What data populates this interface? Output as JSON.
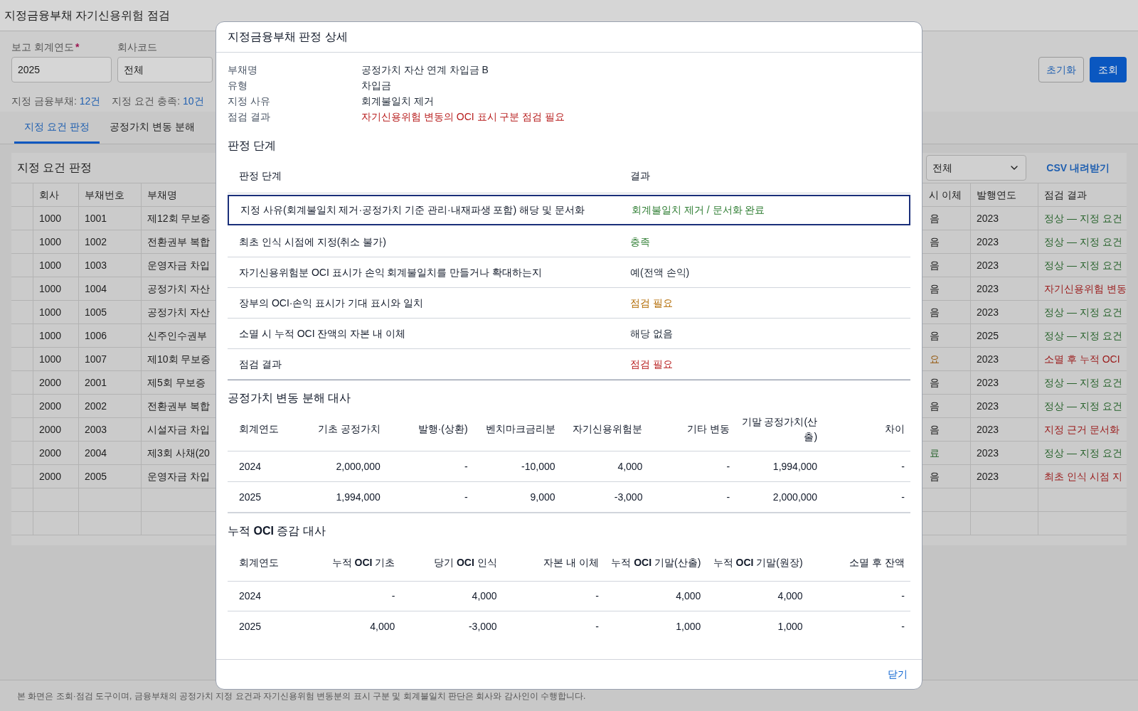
{
  "page_title": "지정금융부채 자기신용위험 점검",
  "filters": [
    {
      "label": "보고 회계연도",
      "required_mark": "*",
      "value": "2025",
      "kind": "input"
    },
    {
      "label": "회사코드",
      "value": "전체",
      "kind": "select"
    }
  ],
  "buttons": [
    {
      "label": "초기화",
      "primary": false
    },
    {
      "label": "조회",
      "primary": true
    }
  ],
  "summary": [
    {
      "label": "지정 금융부채:",
      "value": "12건"
    },
    {
      "label": "지정 요건 충족:",
      "value": "10건"
    }
  ],
  "tabs": [
    {
      "label": "지정 요건 판정",
      "selected": true
    },
    {
      "label": "공정가치 변동 분해",
      "selected": false
    }
  ],
  "panel": {
    "title": "지정 요건 판정",
    "filter_value": "전체",
    "csv_button": "CSV 내려받기",
    "columns": [
      "회사",
      "부채번호",
      "부채명",
      "시 이체",
      "발행연도",
      "점검 결과"
    ],
    "rows": [
      {
        "company": "1000",
        "number": "1001",
        "name": "제12회 무보증",
        "transfer": {
          "text": "음"
        },
        "year": "2023",
        "result": {
          "text": "정상 — 지정 요건",
          "color": "#2a642e"
        }
      },
      {
        "company": "1000",
        "number": "1002",
        "name": "전환권부 복합",
        "transfer": {
          "text": "음"
        },
        "year": "2023",
        "result": {
          "text": "정상 — 지정 요건",
          "color": "#2a642e"
        }
      },
      {
        "company": "1000",
        "number": "1003",
        "name": "운영자금 차입",
        "transfer": {
          "text": "음"
        },
        "year": "2023",
        "result": {
          "text": "정상 — 지정 요건",
          "color": "#2a642e"
        }
      },
      {
        "company": "1000",
        "number": "1004",
        "name": "공정가치 자산",
        "transfer": {
          "text": "음"
        },
        "year": "2023",
        "result": {
          "text": "자기신용위험 변동",
          "color": "#9a1a1a"
        }
      },
      {
        "company": "1000",
        "number": "1005",
        "name": "공정가치 자산",
        "transfer": {
          "text": "음"
        },
        "year": "2023",
        "result": {
          "text": "정상 — 지정 요건",
          "color": "#2a642e"
        }
      },
      {
        "company": "1000",
        "number": "1006",
        "name": "신주인수권부",
        "transfer": {
          "text": "음"
        },
        "year": "2025",
        "result": {
          "text": "정상 — 지정 요건",
          "color": "#2a642e"
        }
      },
      {
        "company": "1000",
        "number": "1007",
        "name": "제10회 무보증",
        "transfer": {
          "text": "요",
          "color": "#955a10"
        },
        "year": "2023",
        "result": {
          "text": "소멸 후 누적 OCI",
          "color": "#9a1a1a"
        }
      },
      {
        "company": "2000",
        "number": "2001",
        "name": "제5회 무보증",
        "transfer": {
          "text": "음"
        },
        "year": "2023",
        "result": {
          "text": "정상 — 지정 요건",
          "color": "#2a642e"
        }
      },
      {
        "company": "2000",
        "number": "2002",
        "name": "전환권부 복합",
        "transfer": {
          "text": "음"
        },
        "year": "2023",
        "result": {
          "text": "정상 — 지정 요건",
          "color": "#2a642e"
        }
      },
      {
        "company": "2000",
        "number": "2003",
        "name": "시설자금 차입",
        "transfer": {
          "text": "음"
        },
        "year": "2023",
        "result": {
          "text": "지정 근거 문서화",
          "color": "#9a1a1a"
        }
      },
      {
        "company": "2000",
        "number": "2004",
        "name": "제3회 사채(20",
        "transfer": {
          "text": "료",
          "color": "#2a642e"
        },
        "year": "2023",
        "result": {
          "text": "정상 — 지정 요건",
          "color": "#2a642e"
        }
      },
      {
        "company": "2000",
        "number": "2005",
        "name": "운영자금 차입",
        "transfer": {
          "text": "음"
        },
        "year": "2023",
        "result": {
          "text": "최초 인식 시점 지",
          "color": "#9a1a1a"
        }
      }
    ]
  },
  "footer_note": "본 화면은 조회·점검 도구이며, 금융부채의 공정가치 지정 요건과 자기신용위험 변동분의 표시 구분 및 회계불일치 판단은 회사와 감사인이 수행합니다.",
  "modal": {
    "title": "지정금융부채 판정 상세",
    "info": [
      {
        "label": "부채명",
        "value": "공정가치 자산 연계 차입금 B",
        "color": "#1f2937"
      },
      {
        "label": "유형",
        "value": "차입금",
        "color": "#1f2937"
      },
      {
        "label": "지정 사유",
        "value": "회계불일치 제거",
        "color": "#1f2937"
      },
      {
        "label": "점검 결과",
        "value": "자기신용위험 변동의 OCI 표시 구분 점검 필요",
        "color": "#b71c1c"
      }
    ],
    "steps": {
      "title": "판정 단계",
      "columns": [
        "판정 단계",
        "결과"
      ],
      "rows": [
        {
          "step": "지정 사유(회계불일치 제거·공정가치 기준 관리·내재파생 포함) 해당 및 문서화",
          "result": "회계불일치 제거 / 문서화 완료",
          "color": "#2e7d32",
          "selected": true
        },
        {
          "step": "최초 인식 시점에 지정(취소 불가)",
          "result": "충족",
          "color": "#2e7d32",
          "selected": false
        },
        {
          "step": "자기신용위험분 OCI 표시가 손익 회계불일치를 만들거나 확대하는지",
          "result": "예(전액 손익)",
          "color": "#1f2937",
          "selected": false
        },
        {
          "step": "장부의 OCI·손익 표시가 기대 표시와 일치",
          "result": "점검 필요",
          "color": "#b26a00",
          "selected": false
        },
        {
          "step": "소멸 시 누적 OCI 잔액의 자본 내 이체",
          "result": "해당 없음",
          "color": "#1f2937",
          "selected": false
        },
        {
          "step": "점검 결과",
          "result": "점검 필요",
          "color": "#b71c1c",
          "selected": false
        }
      ]
    },
    "fair_value": {
      "title": "공정가치 변동 분해 대사",
      "columns": [
        "회계연도",
        "기초 공정가치",
        "발행·(상환)",
        "벤치마크금리분",
        "자기신용위험분",
        "기타 변동",
        "기말 공정가치(산출)",
        "차이"
      ],
      "rows": [
        [
          "2024",
          "2,000,000",
          "-",
          "-10,000",
          "4,000",
          "-",
          "1,994,000",
          "-"
        ],
        [
          "2025",
          "1,994,000",
          "-",
          "9,000",
          "-3,000",
          "-",
          "2,000,000",
          "-"
        ]
      ]
    },
    "oci": {
      "title": "누적 **OCI** 증감 대사",
      "columns": [
        "회계연도",
        "누적 **OCI** 기초",
        "당기 **OCI** 인식",
        "자본 내 이체",
        "누적 **OCI** 기말(산출)",
        "누적 **OCI** 기말(원장)",
        "소멸 후 잔액"
      ],
      "rows": [
        [
          "2024",
          "-",
          "4,000",
          "-",
          "4,000",
          "4,000",
          "-"
        ],
        [
          "2025",
          "4,000",
          "-3,000",
          "-",
          "1,000",
          "1,000",
          "-"
        ]
      ]
    },
    "close_button": "닫기"
  }
}
